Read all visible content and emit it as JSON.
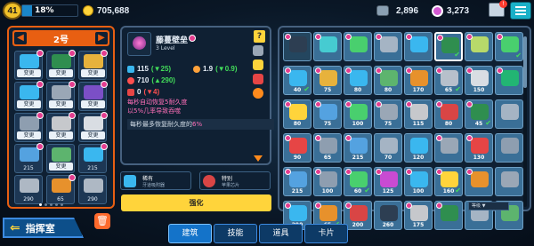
{
  "topbar": {
    "level": "41",
    "xp_text": "18%",
    "xp_fraction": 0.18,
    "coins": "705,688",
    "parts": "2,896",
    "gems": "3,273",
    "mail_badge": "!"
  },
  "left_panel": {
    "floor_label": "2号",
    "slots": [
      {
        "type": "cap",
        "text": "变更",
        "art": "#3ab7ef",
        "m": true
      },
      {
        "type": "cap",
        "text": "变更",
        "art": "#2f8e4f",
        "m": true
      },
      {
        "type": "cap",
        "text": "变更",
        "art": "#e7b23c",
        "m": true
      },
      {
        "type": "cap",
        "text": "变更",
        "art": "#3ab7ef",
        "m": true
      },
      {
        "type": "cap",
        "text": "变更",
        "art": "#9aa7b6",
        "m": true
      },
      {
        "type": "cap",
        "text": "变更",
        "art": "#7b4fc6",
        "m": true
      },
      {
        "type": "cap",
        "text": "变更",
        "art": "#8e9eb0",
        "m": true
      },
      {
        "type": "cap",
        "text": "变更",
        "art": "#c6c8cc",
        "m": true
      },
      {
        "type": "cap",
        "text": "变更",
        "art": "#d9dde3",
        "m": true
      },
      {
        "type": "num",
        "text": "215",
        "art": "#54a2e0",
        "m": true
      },
      {
        "type": "cap",
        "text": "变更",
        "art": "#5db46e",
        "m": false
      },
      {
        "type": "num",
        "text": "215",
        "art": "#3ab7ef",
        "m": true
      },
      {
        "type": "num",
        "text": "290",
        "art": "#aeb8c4",
        "m": false
      },
      {
        "type": "num",
        "text": "65",
        "art": "#e7912c",
        "m": true
      },
      {
        "type": "num",
        "text": "290",
        "art": "#aeb8c4",
        "m": false
      }
    ]
  },
  "commander": {
    "label": "指挥室",
    "back": "⇐"
  },
  "delete_icon": "🗑",
  "detail": {
    "name": "藤蔓壁垒",
    "level": "3 Level",
    "help": "?",
    "stats": {
      "attack": "115",
      "attack_delta": "(▼25)",
      "speed": "1.9",
      "speed_delta": "(▼0.9)",
      "health": "710",
      "health_delta": "(▲290)",
      "armor": "0",
      "armor_delta": "(▼4)"
    },
    "desc_line1": "每秒自动恢复5耐久度",
    "desc_line2": "以5%几率导致吞噬",
    "desc_bar_prefix": "每秒最多恢复耐久度的",
    "desc_bar_value": "6%"
  },
  "traits": [
    {
      "label": "稀有",
      "sub": "牙道吸附器"
    },
    {
      "label": "特别",
      "sub": "苹果芯片"
    }
  ],
  "upgrade_label": "强化",
  "towers": [
    {
      "num": "",
      "art": "#2d3e52",
      "m": true,
      "dark": true
    },
    {
      "num": "",
      "art": "#46cbd1",
      "m": true
    },
    {
      "num": "",
      "art": "#49cf6e",
      "m": true
    },
    {
      "num": "",
      "art": "#a5b4c4",
      "m": true
    },
    {
      "num": "",
      "art": "#3ab7ef",
      "m": true
    },
    {
      "num": "",
      "art": "#2f8e4f",
      "m": true,
      "selected": true,
      "check": true
    },
    {
      "num": "",
      "art": "#b7d96a",
      "m": true
    },
    {
      "num": "",
      "art": "#49cf6e",
      "m": true,
      "check": true
    },
    {
      "num": "40",
      "art": "#3ab7ef",
      "m": true,
      "check": true
    },
    {
      "num": "75",
      "art": "#e7b23c",
      "m": true
    },
    {
      "num": "80",
      "art": "#3ab7ef",
      "m": true
    },
    {
      "num": "80",
      "art": "#5db46e",
      "m": true
    },
    {
      "num": "170",
      "art": "#e7912c",
      "m": true
    },
    {
      "num": "65",
      "art": "#b7c0cb",
      "m": true,
      "check": true
    },
    {
      "num": "150",
      "art": "#d9dde3",
      "m": true
    },
    {
      "num": "",
      "art": "#22b573",
      "m": true
    },
    {
      "num": "80",
      "art": "#ffd43b",
      "m": true
    },
    {
      "num": "75",
      "art": "#54a2e0",
      "m": true
    },
    {
      "num": "100",
      "art": "#49cf6e",
      "m": true
    },
    {
      "num": "75",
      "art": "#9aa7b6",
      "m": true
    },
    {
      "num": "115",
      "art": "#c6c8cc",
      "m": true
    },
    {
      "num": "80",
      "art": "#d94545",
      "m": true
    },
    {
      "num": "45",
      "art": "#2f8e4f",
      "m": true,
      "check": true
    },
    {
      "num": "",
      "art": "#a5b4c4",
      "m": false
    },
    {
      "num": "90",
      "art": "#e64545",
      "m": true
    },
    {
      "num": "65",
      "art": "#8e9eb0",
      "m": true
    },
    {
      "num": "215",
      "art": "#54a2e0",
      "m": true
    },
    {
      "num": "70",
      "art": "#a5b4c4",
      "m": false
    },
    {
      "num": "120",
      "art": "#3ab7ef",
      "m": false
    },
    {
      "num": "",
      "art": "#9aa7b6",
      "m": true
    },
    {
      "num": "130",
      "art": "#e64545",
      "m": true
    },
    {
      "num": "",
      "art": "#8e9eb0",
      "m": false
    },
    {
      "num": "215",
      "art": "#54a2e0",
      "m": true
    },
    {
      "num": "100",
      "art": "#8e9eb0",
      "m": true
    },
    {
      "num": "60",
      "art": "#49cf6e",
      "m": true,
      "check": true
    },
    {
      "num": "125",
      "art": "#c84bd2",
      "m": true
    },
    {
      "num": "100",
      "art": "#3ab7ef",
      "m": true
    },
    {
      "num": "160",
      "art": "#ffd43b",
      "m": true,
      "check": true
    },
    {
      "num": "",
      "art": "#e7912c",
      "m": true
    },
    {
      "num": "",
      "art": "#9aa7b6",
      "m": false
    },
    {
      "num": "290",
      "art": "#3ab7ef",
      "m": true
    },
    {
      "num": "65",
      "art": "#e7912c",
      "m": true,
      "check": true
    },
    {
      "num": "200",
      "art": "#d94545",
      "m": true
    },
    {
      "num": "260",
      "art": "#2d3e52",
      "m": false
    },
    {
      "num": "175",
      "art": "#c6c8cc",
      "m": true
    },
    {
      "num": "",
      "art": "#2f8e4f",
      "m": true
    },
    {
      "num": "",
      "art": "#a5b4c4",
      "m": false
    },
    {
      "num": "",
      "art": "#5db46e",
      "m": false
    }
  ],
  "sort_label": "等级 ▼",
  "tabs": [
    "建筑",
    "技能",
    "道具",
    "卡片"
  ],
  "active_tab_index": 0
}
